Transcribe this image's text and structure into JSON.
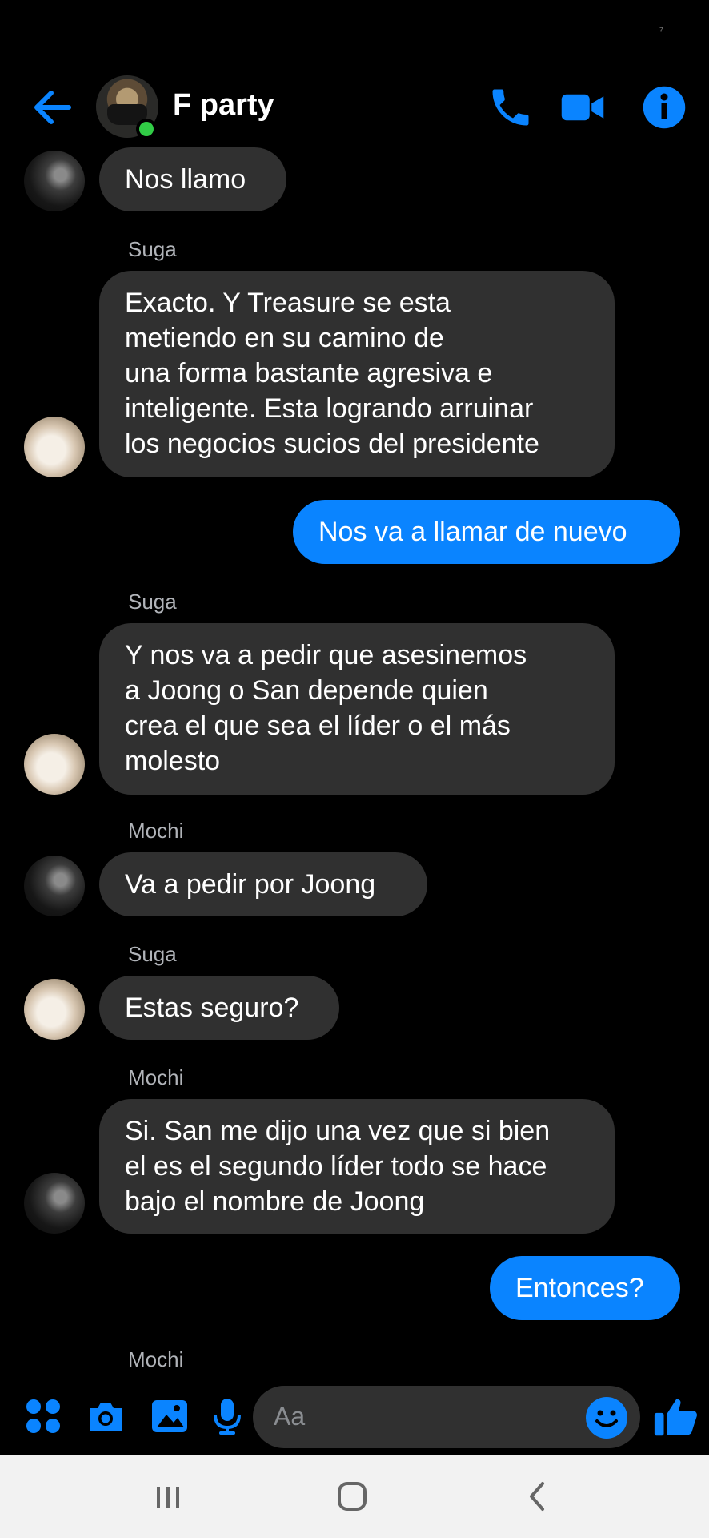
{
  "status_bar": {
    "glyph": "⁷"
  },
  "header": {
    "title": "F party",
    "icons": {
      "back": "back-arrow-icon",
      "call": "phone-icon",
      "video": "video-camera-icon",
      "info": "info-icon"
    },
    "accent_color": "#0a84ff",
    "online_color": "#31cc46"
  },
  "messages": [
    {
      "direction": "in",
      "text": "Nos llamo"
    },
    {
      "direction": "in",
      "sender": "Suga",
      "lines": [
        "Exacto. Y Treasure se esta",
        "metiendo en su camino de",
        "una forma bastante agresiva e",
        "inteligente. Esta logrando arruinar",
        "los negocios sucios del presidente"
      ]
    },
    {
      "direction": "out",
      "text": "Nos va a llamar de nuevo"
    },
    {
      "direction": "in",
      "sender": "Suga",
      "lines": [
        "Y nos va a pedir que asesinemos",
        "a Joong o San depende quien",
        "crea el que sea el líder o el más",
        "molesto"
      ]
    },
    {
      "direction": "in",
      "sender": "Mochi",
      "text": "Va a pedir por Joong"
    },
    {
      "direction": "in",
      "sender": "Suga",
      "text": "Estas seguro?"
    },
    {
      "direction": "in",
      "sender": "Mochi",
      "lines": [
        "Si. San me dijo una vez que si bien",
        "el es el segundo líder todo se hace",
        "bajo el nombre de Joong"
      ]
    },
    {
      "direction": "out",
      "text": "Entonces?"
    },
    {
      "direction": "in",
      "sender": "Mochi",
      "text": ""
    }
  ],
  "composer": {
    "placeholder": "Aa",
    "icons": [
      "apps-grid-icon",
      "camera-icon",
      "image-icon",
      "microphone-icon",
      "emoji-icon",
      "thumbs-up-icon"
    ]
  },
  "nav_bar": {
    "icons": [
      "recent-apps-icon",
      "home-icon",
      "back-icon"
    ]
  }
}
